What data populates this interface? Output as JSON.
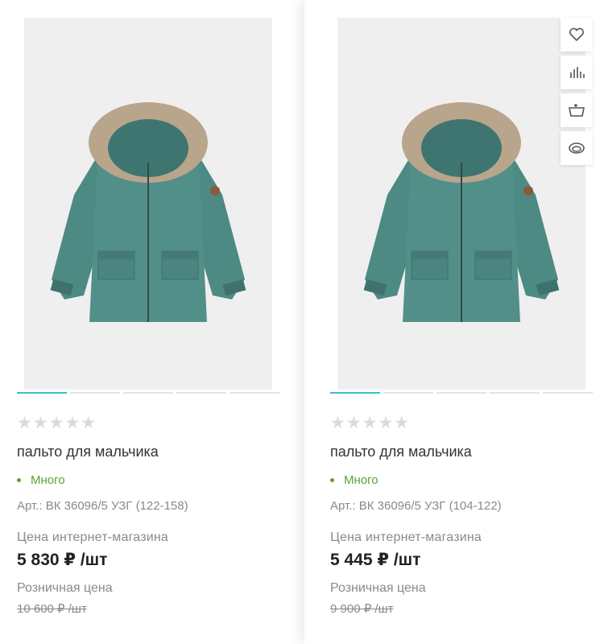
{
  "products": [
    {
      "stars": "★★★★★",
      "title": "пальто для мальчика",
      "stock": "Много",
      "sku": "Арт.: ВК 36096/5 УЗГ (122-158)",
      "price_label": "Цена интернет-магазина",
      "price": "5 830 ₽ /шт",
      "retail_label": "Розничная цена",
      "retail_price": "10 600 ₽ /шт",
      "photo_index": 1,
      "photo_count": 5
    },
    {
      "stars": "★★★★★",
      "title": "пальто для мальчика",
      "stock": "Много",
      "sku": "Арт.: ВК 36096/5 УЗГ (104-122)",
      "price_label": "Цена интернет-магазина",
      "price": "5 445 ₽ /шт",
      "retail_label": "Розничная цена",
      "retail_price": "9 900 ₽ /шт",
      "photo_index": 1,
      "photo_count": 5
    }
  ],
  "actions": [
    "heart-icon",
    "compare-icon",
    "cart-icon",
    "eye-icon"
  ],
  "colors": {
    "accent": "#38c0cf",
    "stock": "#5aa332",
    "coat": "#4d8a84",
    "fur": "#b9a58c"
  }
}
